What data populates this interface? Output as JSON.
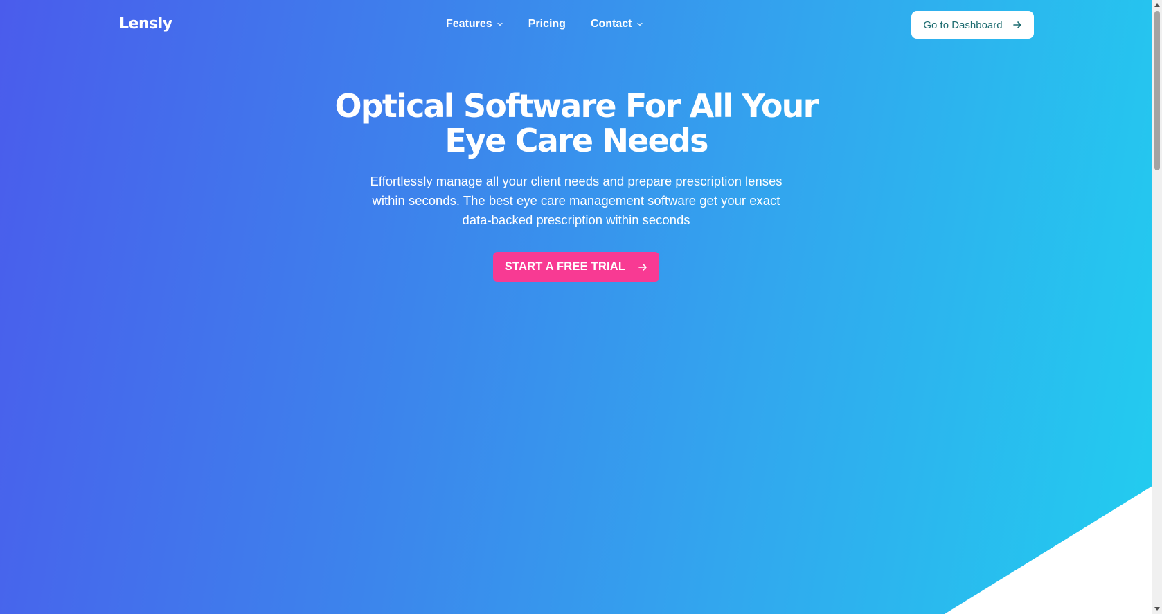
{
  "brand": {
    "logo_text": "Lensly"
  },
  "nav": {
    "items": [
      {
        "label": "Features",
        "has_dropdown": true
      },
      {
        "label": "Pricing",
        "has_dropdown": false
      },
      {
        "label": "Contact",
        "has_dropdown": true
      }
    ],
    "dashboard_button": "Go to Dashboard"
  },
  "hero": {
    "title": "Optical Software For All Your Eye Care Needs",
    "subtitle": "Effortlessly manage all your client needs and prepare prescription lenses within seconds. The best eye care management software get your exact data-backed prescription within seconds",
    "cta_label": "START A FREE TRIAL"
  },
  "icons": {
    "nav_dropdown": "chevron-down-icon",
    "dashboard_arrow": "arrow-right-icon",
    "cta_arrow": "arrow-right-icon"
  },
  "colors": {
    "gradient_start": "#4a5cec",
    "gradient_end": "#22cdef",
    "cta_background": "#f83a93",
    "dashboard_text": "#1e6c70",
    "text_on_gradient": "#ffffff"
  }
}
